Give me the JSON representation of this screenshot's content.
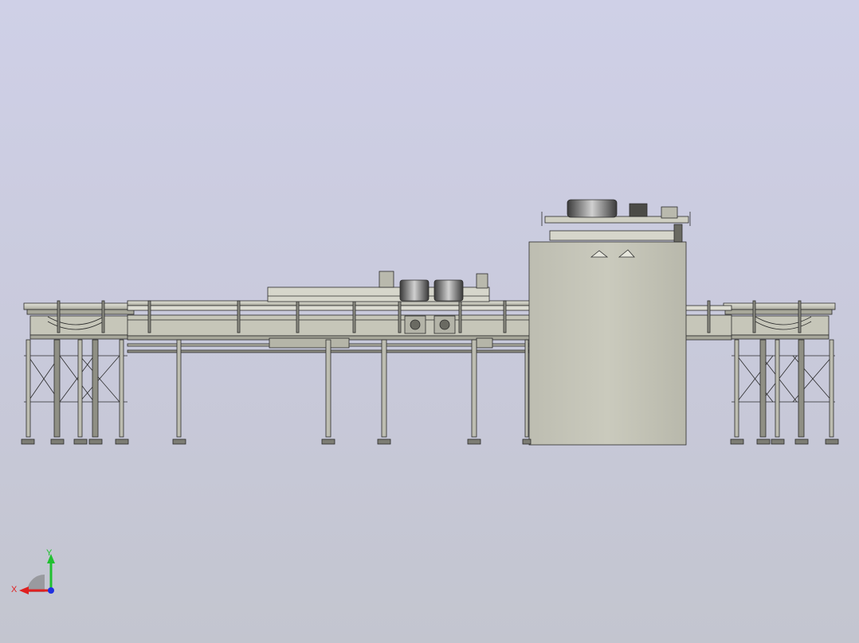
{
  "viewport": {
    "background_top": "#cfd0e7",
    "background_bottom": "#c3c5cf"
  },
  "model": {
    "description_icon": "conveyor-machine-assembly",
    "body_color": "#c9c9bc",
    "body_dark": "#a7a79a",
    "line_color": "#2b2b2b"
  },
  "triad": {
    "x_label": "X",
    "y_label": "Y",
    "x_color": "#e02020",
    "y_color": "#20c030",
    "z_color": "#2030e0"
  }
}
